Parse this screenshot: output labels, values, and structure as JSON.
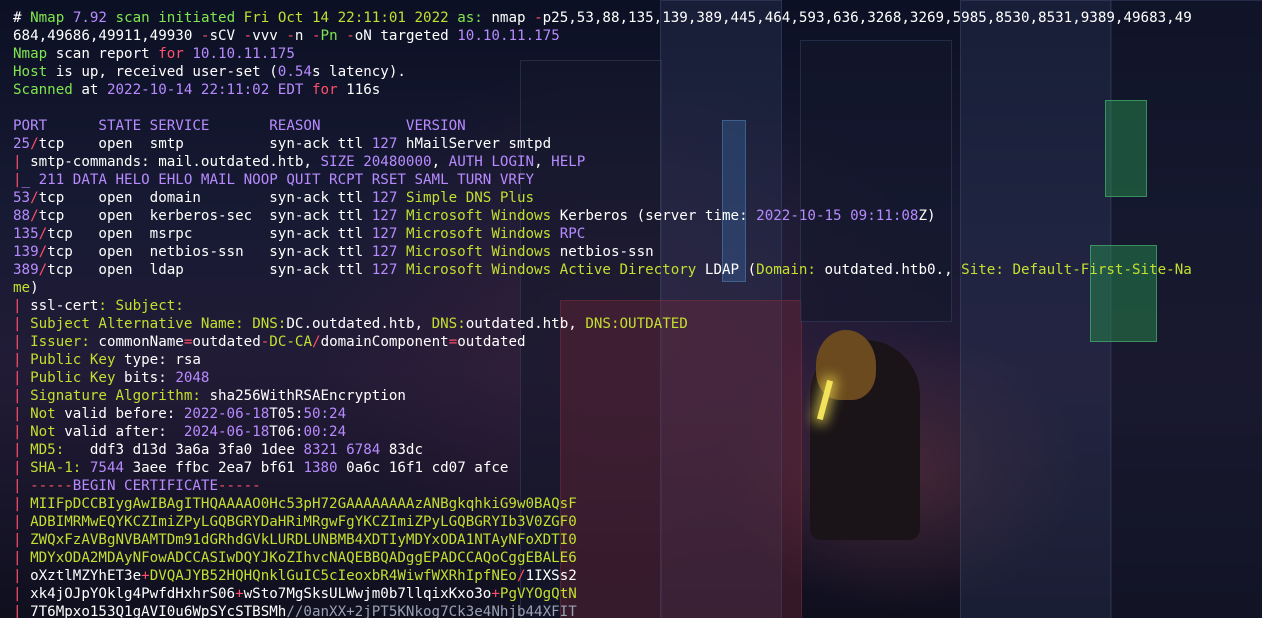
{
  "lines": [
    [
      [
        "w",
        "# "
      ],
      [
        "g",
        "Nmap"
      ],
      [
        "w",
        " "
      ],
      [
        "p",
        "7.92"
      ],
      [
        "w",
        " "
      ],
      [
        "g",
        "scan initiated"
      ],
      [
        "w",
        " "
      ],
      [
        "y",
        "Fri Oct 14 22:11:01 2022"
      ],
      [
        "w",
        " "
      ],
      [
        "g",
        "as:"
      ],
      [
        "w",
        " nmap "
      ],
      [
        "r",
        "-"
      ],
      [
        "w",
        "p25,53,88,135,139,389,445,464,593,636,3268,3269,5985,8530,8531,9389,49683,49"
      ]
    ],
    [
      [
        "w",
        "684,49686,49911,49930 "
      ],
      [
        "r",
        "-"
      ],
      [
        "w",
        "sCV "
      ],
      [
        "r",
        "-"
      ],
      [
        "w",
        "vvv "
      ],
      [
        "r",
        "-"
      ],
      [
        "w",
        "n "
      ],
      [
        "r",
        "-"
      ],
      [
        "g",
        "Pn"
      ],
      [
        "w",
        " "
      ],
      [
        "r",
        "-"
      ],
      [
        "w",
        "oN targeted "
      ],
      [
        "p",
        "10.10.11.175"
      ]
    ],
    [
      [
        "g",
        "Nmap"
      ],
      [
        "w",
        " scan report "
      ],
      [
        "r",
        "for"
      ],
      [
        "w",
        " "
      ],
      [
        "p",
        "10.10.11.175"
      ]
    ],
    [
      [
        "g",
        "Host"
      ],
      [
        "w",
        " is up, received user-set ("
      ],
      [
        "p",
        "0.54"
      ],
      [
        "w",
        "s latency)."
      ]
    ],
    [
      [
        "g",
        "Scanned"
      ],
      [
        "w",
        " at "
      ],
      [
        "p",
        "2022-10-14 22:11:02 EDT"
      ],
      [
        "w",
        " "
      ],
      [
        "r",
        "for"
      ],
      [
        "w",
        " 116s"
      ]
    ],
    [],
    [
      [
        "p",
        "PORT      STATE SERVICE       REASON          VERSION"
      ]
    ],
    [
      [
        "p",
        "25"
      ],
      [
        "r",
        "/"
      ],
      [
        "w",
        "tcp    open  smtp          syn-ack ttl "
      ],
      [
        "p",
        "127"
      ],
      [
        "w",
        " hMailServer smtpd"
      ]
    ],
    [
      [
        "r",
        "|"
      ],
      [
        "w",
        " smtp-commands: mail.outdated.htb, "
      ],
      [
        "p",
        "SIZE 20480000"
      ],
      [
        "w",
        ", "
      ],
      [
        "p",
        "AUTH LOGIN"
      ],
      [
        "w",
        ", "
      ],
      [
        "p",
        "HELP"
      ]
    ],
    [
      [
        "r",
        "|"
      ],
      [
        "p",
        "_ 211 DATA HELO EHLO MAIL NOOP QUIT RCPT RSET SAML TURN VRFY"
      ]
    ],
    [
      [
        "p",
        "53"
      ],
      [
        "r",
        "/"
      ],
      [
        "w",
        "tcp    open  domain        syn-ack ttl "
      ],
      [
        "p",
        "127"
      ],
      [
        "w",
        " "
      ],
      [
        "y",
        "Simple DNS Plus"
      ]
    ],
    [
      [
        "p",
        "88"
      ],
      [
        "r",
        "/"
      ],
      [
        "w",
        "tcp    open  kerberos-sec  syn-ack ttl "
      ],
      [
        "p",
        "127"
      ],
      [
        "w",
        " "
      ],
      [
        "y",
        "Microsoft Windows"
      ],
      [
        "w",
        " Kerberos (server time: "
      ],
      [
        "p",
        "2022-10-15 09:11:08"
      ],
      [
        "w",
        "Z)"
      ]
    ],
    [
      [
        "p",
        "135"
      ],
      [
        "r",
        "/"
      ],
      [
        "w",
        "tcp   open  msrpc         syn-ack ttl "
      ],
      [
        "p",
        "127"
      ],
      [
        "w",
        " "
      ],
      [
        "y",
        "Microsoft Windows"
      ],
      [
        "w",
        " "
      ],
      [
        "p",
        "RPC"
      ]
    ],
    [
      [
        "p",
        "139"
      ],
      [
        "r",
        "/"
      ],
      [
        "w",
        "tcp   open  netbios-ssn   syn-ack ttl "
      ],
      [
        "p",
        "127"
      ],
      [
        "w",
        " "
      ],
      [
        "y",
        "Microsoft Windows"
      ],
      [
        "w",
        " netbios-ssn"
      ]
    ],
    [
      [
        "p",
        "389"
      ],
      [
        "r",
        "/"
      ],
      [
        "w",
        "tcp   open  ldap          syn-ack ttl "
      ],
      [
        "p",
        "127"
      ],
      [
        "w",
        " "
      ],
      [
        "y",
        "Microsoft Windows Active Directory"
      ],
      [
        "w",
        " LDAP ("
      ],
      [
        "y",
        "Domain:"
      ],
      [
        "w",
        " outdated.htb0., "
      ],
      [
        "y",
        "Site:"
      ],
      [
        "w",
        " "
      ],
      [
        "y",
        "Default-First-Site-Na"
      ]
    ],
    [
      [
        "y",
        "me"
      ],
      [
        "w",
        ")"
      ]
    ],
    [
      [
        "r",
        "|"
      ],
      [
        "w",
        " ssl-cert"
      ],
      [
        "y",
        ":"
      ],
      [
        "w",
        " "
      ],
      [
        "y",
        "Subject:"
      ]
    ],
    [
      [
        "r",
        "|"
      ],
      [
        "w",
        " "
      ],
      [
        "y",
        "Subject Alternative Name:"
      ],
      [
        "w",
        " "
      ],
      [
        "y",
        "DNS:"
      ],
      [
        "w",
        "DC.outdated.htb, "
      ],
      [
        "y",
        "DNS:"
      ],
      [
        "w",
        "outdated.htb, "
      ],
      [
        "y",
        "DNS:OUTDATED"
      ]
    ],
    [
      [
        "r",
        "|"
      ],
      [
        "w",
        " "
      ],
      [
        "y",
        "Issuer:"
      ],
      [
        "w",
        " commonName"
      ],
      [
        "r",
        "="
      ],
      [
        "w",
        "outdated"
      ],
      [
        "r",
        "-"
      ],
      [
        "y",
        "DC-CA"
      ],
      [
        "r",
        "/"
      ],
      [
        "w",
        "domainComponent"
      ],
      [
        "r",
        "="
      ],
      [
        "w",
        "outdated"
      ]
    ],
    [
      [
        "r",
        "|"
      ],
      [
        "w",
        " "
      ],
      [
        "y",
        "Public Key"
      ],
      [
        "w",
        " type: rsa"
      ]
    ],
    [
      [
        "r",
        "|"
      ],
      [
        "w",
        " "
      ],
      [
        "y",
        "Public Key"
      ],
      [
        "w",
        " bits: "
      ],
      [
        "p",
        "2048"
      ]
    ],
    [
      [
        "r",
        "|"
      ],
      [
        "w",
        " "
      ],
      [
        "y",
        "Signature Algorithm:"
      ],
      [
        "w",
        " sha256WithRSAEncryption"
      ]
    ],
    [
      [
        "r",
        "|"
      ],
      [
        "w",
        " "
      ],
      [
        "y",
        "Not"
      ],
      [
        "w",
        " valid before: "
      ],
      [
        "p",
        "2022-06-18"
      ],
      [
        "w",
        "T05:"
      ],
      [
        "p",
        "50:24"
      ]
    ],
    [
      [
        "r",
        "|"
      ],
      [
        "w",
        " "
      ],
      [
        "y",
        "Not"
      ],
      [
        "w",
        " valid after:  "
      ],
      [
        "p",
        "2024-06-18"
      ],
      [
        "w",
        "T06:"
      ],
      [
        "p",
        "00:24"
      ]
    ],
    [
      [
        "r",
        "|"
      ],
      [
        "w",
        " "
      ],
      [
        "y",
        "MD5:"
      ],
      [
        "w",
        "   ddf3 d13d 3a6a 3fa0 1dee "
      ],
      [
        "p",
        "8321 6784"
      ],
      [
        "w",
        " 83dc"
      ]
    ],
    [
      [
        "r",
        "|"
      ],
      [
        "w",
        " "
      ],
      [
        "y",
        "SHA-1:"
      ],
      [
        "w",
        " "
      ],
      [
        "p",
        "7544"
      ],
      [
        "w",
        " 3aee ffbc 2ea7 bf61 "
      ],
      [
        "p",
        "1380"
      ],
      [
        "w",
        " 0a6c 16f1 cd07 afce"
      ]
    ],
    [
      [
        "r",
        "| -----"
      ],
      [
        "p",
        "BEGIN CERTIFICATE"
      ],
      [
        "r",
        "-----"
      ]
    ],
    [
      [
        "r",
        "|"
      ],
      [
        "w",
        " "
      ],
      [
        "y",
        "MIIFpDCCBIygAwIBAgITHQAAAAO0Hc53pH72GAAAAAAAAzANBgkqhkiG9w0BAQsF"
      ]
    ],
    [
      [
        "r",
        "|"
      ],
      [
        "w",
        " "
      ],
      [
        "y",
        "ADBIMRMwEQYKCZImiZPyLGQBGRYDaHRiMRgwFgYKCZImiZPyLGQBGRYIb3V0ZGF0"
      ]
    ],
    [
      [
        "r",
        "|"
      ],
      [
        "w",
        " "
      ],
      [
        "y",
        "ZWQxFzAVBgNVBAMTDm91dGRhdGVkLURDLUNBMB4XDTIyMDYxODA1NTAyNFoXDTI0"
      ]
    ],
    [
      [
        "r",
        "|"
      ],
      [
        "w",
        " "
      ],
      [
        "y",
        "MDYxODA2MDAyNFowADCCASIwDQYJKoZIhvcNAQEBBQADggEPADCCAQoCggEBALE6"
      ]
    ],
    [
      [
        "r",
        "|"
      ],
      [
        "w",
        " oXztlMZYhET3e"
      ],
      [
        "r",
        "+"
      ],
      [
        "y",
        "DVQAJYB52HQHQnklGuIC5cIeoxbR4WiwfWXRhIpfNEo"
      ],
      [
        "r",
        "/"
      ],
      [
        "w",
        "1IXSs2"
      ]
    ],
    [
      [
        "r",
        "|"
      ],
      [
        "w",
        " xk4jOJpYOklg4PwfdHxhrS06"
      ],
      [
        "r",
        "+"
      ],
      [
        "w",
        "wSto7MgSksULWwjm0b7llqixKxo3o"
      ],
      [
        "r",
        "+"
      ],
      [
        "y",
        "PgVYOgQtN"
      ]
    ],
    [
      [
        "r",
        "|"
      ],
      [
        "w",
        " 7T6Mpxo153Q1gAVI0u6WpSYcSTBSMh"
      ],
      [
        "d",
        "//0anXX+2jPT5KNkog7Ck3e4Nhjb44XFIT"
      ]
    ]
  ]
}
